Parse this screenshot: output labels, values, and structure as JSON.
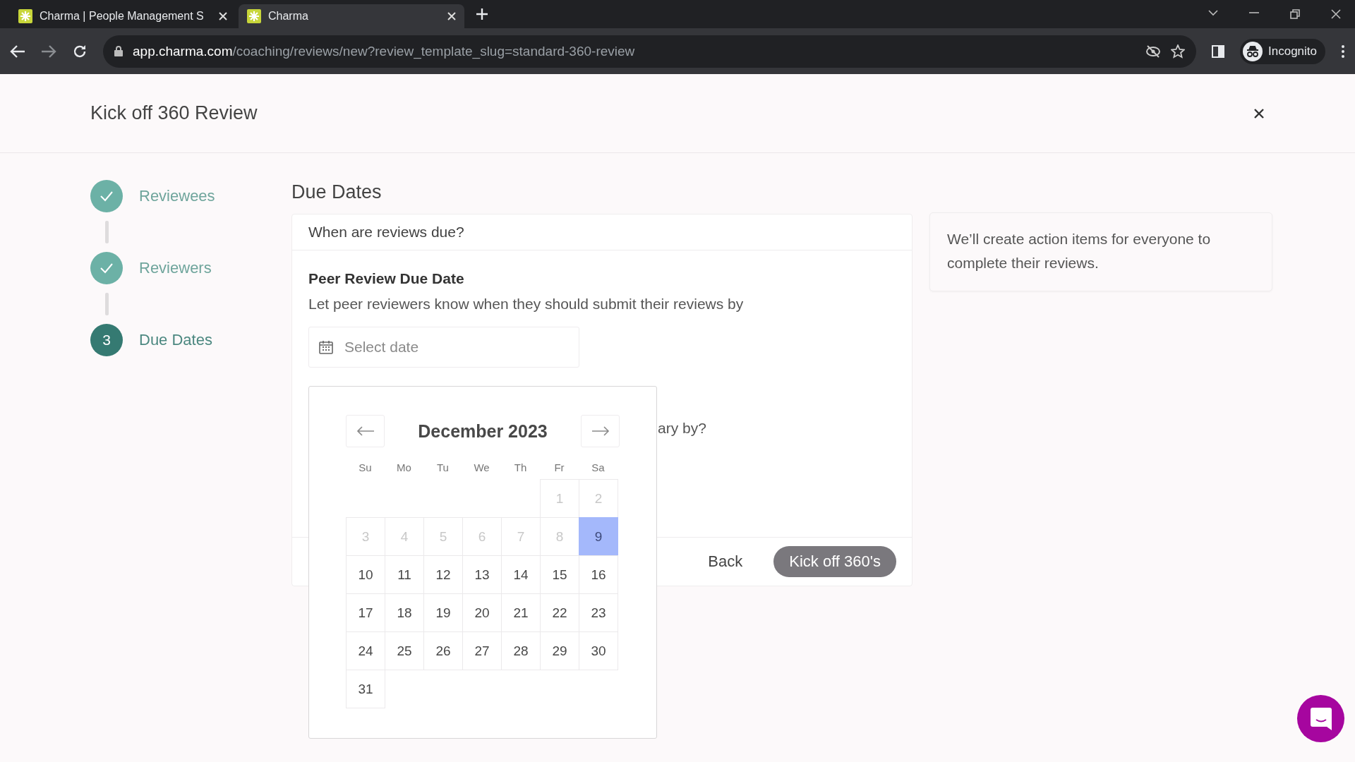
{
  "browser": {
    "tabs": [
      {
        "title": "Charma | People Management S",
        "selected": false
      },
      {
        "title": "Charma",
        "selected": true
      }
    ],
    "url_host": "app.charma.com",
    "url_path": "/coaching/reviews/new?review_template_slug=standard-360-review",
    "profile": "Incognito"
  },
  "header": {
    "title": "Kick off 360 Review"
  },
  "steps": [
    {
      "label": "Reviewees",
      "kind": "done"
    },
    {
      "label": "Reviewers",
      "kind": "done"
    },
    {
      "label": "Due Dates",
      "kind": "current",
      "number": "3"
    }
  ],
  "section_title": "Due Dates",
  "card": {
    "question": "When are reviews due?",
    "field_title": "Peer Review Due Date",
    "field_help": "Let peer reviewers know when they should submit their reviews by",
    "date_placeholder": "Select date",
    "partial_question": "ary by?",
    "back": "Back",
    "submit": "Kick off 360's"
  },
  "calendar": {
    "month": "December 2023",
    "weekdays": [
      "Su",
      "Mo",
      "Tu",
      "We",
      "Th",
      "Fr",
      "Sa"
    ],
    "weeks": [
      [
        {
          "day": "1",
          "disabled": true,
          "selected": false
        },
        {
          "day": "2",
          "disabled": true,
          "selected": false
        }
      ],
      [
        {
          "day": "3",
          "disabled": true,
          "selected": false
        },
        {
          "day": "4",
          "disabled": true,
          "selected": false
        },
        {
          "day": "5",
          "disabled": true,
          "selected": false
        },
        {
          "day": "6",
          "disabled": true,
          "selected": false
        },
        {
          "day": "7",
          "disabled": true,
          "selected": false
        },
        {
          "day": "8",
          "disabled": true,
          "selected": false
        },
        {
          "day": "9",
          "disabled": false,
          "selected": true
        }
      ],
      [
        {
          "day": "10",
          "disabled": false,
          "selected": false
        },
        {
          "day": "11",
          "disabled": false,
          "selected": false
        },
        {
          "day": "12",
          "disabled": false,
          "selected": false
        },
        {
          "day": "13",
          "disabled": false,
          "selected": false
        },
        {
          "day": "14",
          "disabled": false,
          "selected": false
        },
        {
          "day": "15",
          "disabled": false,
          "selected": false
        },
        {
          "day": "16",
          "disabled": false,
          "selected": false
        }
      ],
      [
        {
          "day": "17",
          "disabled": false,
          "selected": false
        },
        {
          "day": "18",
          "disabled": false,
          "selected": false
        },
        {
          "day": "19",
          "disabled": false,
          "selected": false
        },
        {
          "day": "20",
          "disabled": false,
          "selected": false
        },
        {
          "day": "21",
          "disabled": false,
          "selected": false
        },
        {
          "day": "22",
          "disabled": false,
          "selected": false
        },
        {
          "day": "23",
          "disabled": false,
          "selected": false
        }
      ],
      [
        {
          "day": "24",
          "disabled": false,
          "selected": false
        },
        {
          "day": "25",
          "disabled": false,
          "selected": false
        },
        {
          "day": "26",
          "disabled": false,
          "selected": false
        },
        {
          "day": "27",
          "disabled": false,
          "selected": false
        },
        {
          "day": "28",
          "disabled": false,
          "selected": false
        },
        {
          "day": "29",
          "disabled": false,
          "selected": false
        },
        {
          "day": "30",
          "disabled": false,
          "selected": false
        }
      ],
      [
        {
          "day": "31",
          "disabled": false,
          "selected": false
        }
      ]
    ]
  },
  "info": {
    "text": "We’ll create action items for everyone to complete their reviews."
  }
}
